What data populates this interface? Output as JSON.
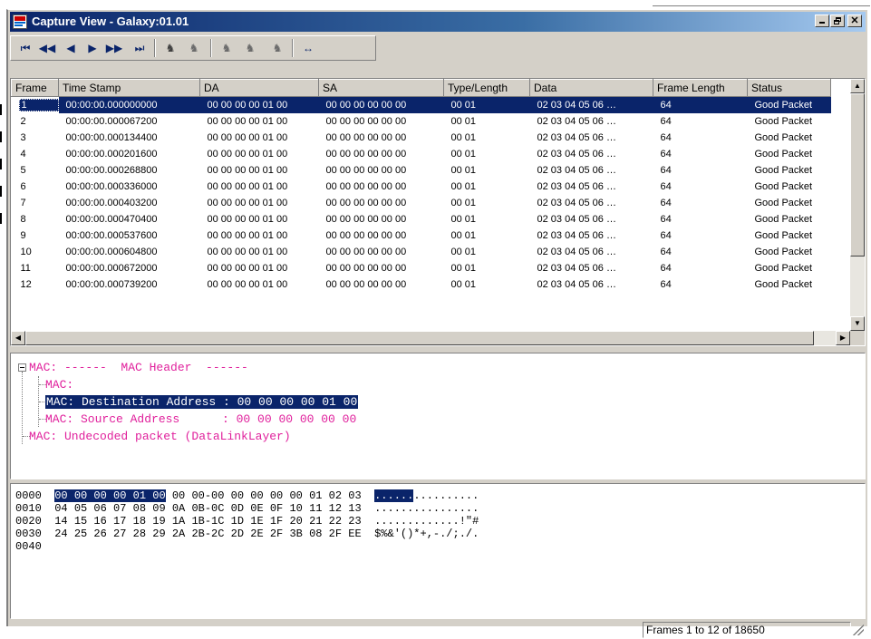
{
  "window": {
    "title": "Capture View - Galaxy:01.01",
    "minimize": "_",
    "close": "✕"
  },
  "toolbar": {
    "first": "⏮",
    "prev_page": "◀◀",
    "prev": "◀",
    "next": "▶",
    "next_page": "▶▶",
    "last": "⏭",
    "find1": "♞",
    "find2": "♞",
    "find3": "♞",
    "find4": "♞",
    "find5": "♞",
    "goto": "↔"
  },
  "list": {
    "columns": [
      "Frame",
      "Time Stamp",
      "DA",
      "SA",
      "Type/Length",
      "Data",
      "Frame Length",
      "Status"
    ],
    "rows": [
      [
        "1",
        "00:00:00.000000000",
        "00 00 00 00 01 00",
        "00 00 00 00 00 00",
        "00 01",
        "02 03 04 05 06 …",
        "64",
        "Good Packet"
      ],
      [
        "2",
        "00:00:00.000067200",
        "00 00 00 00 01 00",
        "00 00 00 00 00 00",
        "00 01",
        "02 03 04 05 06 …",
        "64",
        "Good Packet"
      ],
      [
        "3",
        "00:00:00.000134400",
        "00 00 00 00 01 00",
        "00 00 00 00 00 00",
        "00 01",
        "02 03 04 05 06 …",
        "64",
        "Good Packet"
      ],
      [
        "4",
        "00:00:00.000201600",
        "00 00 00 00 01 00",
        "00 00 00 00 00 00",
        "00 01",
        "02 03 04 05 06 …",
        "64",
        "Good Packet"
      ],
      [
        "5",
        "00:00:00.000268800",
        "00 00 00 00 01 00",
        "00 00 00 00 00 00",
        "00 01",
        "02 03 04 05 06 …",
        "64",
        "Good Packet"
      ],
      [
        "6",
        "00:00:00.000336000",
        "00 00 00 00 01 00",
        "00 00 00 00 00 00",
        "00 01",
        "02 03 04 05 06 …",
        "64",
        "Good Packet"
      ],
      [
        "7",
        "00:00:00.000403200",
        "00 00 00 00 01 00",
        "00 00 00 00 00 00",
        "00 01",
        "02 03 04 05 06 …",
        "64",
        "Good Packet"
      ],
      [
        "8",
        "00:00:00.000470400",
        "00 00 00 00 01 00",
        "00 00 00 00 00 00",
        "00 01",
        "02 03 04 05 06 …",
        "64",
        "Good Packet"
      ],
      [
        "9",
        "00:00:00.000537600",
        "00 00 00 00 01 00",
        "00 00 00 00 00 00",
        "00 01",
        "02 03 04 05 06 …",
        "64",
        "Good Packet"
      ],
      [
        "10",
        "00:00:00.000604800",
        "00 00 00 00 01 00",
        "00 00 00 00 00 00",
        "00 01",
        "02 03 04 05 06 …",
        "64",
        "Good Packet"
      ],
      [
        "11",
        "00:00:00.000672000",
        "00 00 00 00 01 00",
        "00 00 00 00 00 00",
        "00 01",
        "02 03 04 05 06 …",
        "64",
        "Good Packet"
      ],
      [
        "12",
        "00:00:00.000739200",
        "00 00 00 00 01 00",
        "00 00 00 00 00 00",
        "00 01",
        "02 03 04 05 06 …",
        "64",
        "Good Packet"
      ]
    ],
    "selected_row": 0
  },
  "tree": {
    "root": "MAC: ------  MAC Header  ------",
    "child1": "MAC:",
    "child2": "MAC: Destination Address : 00 00 00 00 01 00",
    "child3": "MAC: Source Address      : 00 00 00 00 00 00",
    "sibling": "MAC: Undecoded packet (DataLinkLayer)"
  },
  "hex": {
    "rows": [
      {
        "offset": "0000",
        "sel": "00 00 00 00 01 00",
        "rest": " 00 00-00 00 00 00 00 01 02 03",
        "ascii_sel": "......",
        "ascii_rest": ".........."
      },
      {
        "offset": "0010",
        "sel": "",
        "rest": "04 05 06 07 08 09 0A 0B-0C 0D 0E 0F 10 11 12 13",
        "ascii_sel": "",
        "ascii_rest": "................"
      },
      {
        "offset": "0020",
        "sel": "",
        "rest": "14 15 16 17 18 19 1A 1B-1C 1D 1E 1F 20 21 22 23",
        "ascii_sel": "",
        "ascii_rest": ".............!\"#"
      },
      {
        "offset": "0030",
        "sel": "",
        "rest": "24 25 26 27 28 29 2A 2B-2C 2D 2E 2F 3B 08 2F EE",
        "ascii_sel": "",
        "ascii_rest": "$%&'()*+,-./;./."
      },
      {
        "offset": "0040",
        "sel": "",
        "rest": "",
        "ascii_sel": "",
        "ascii_rest": ""
      }
    ]
  },
  "status": {
    "frames": "Frames 1 to 12 of 18650"
  },
  "colors": {
    "selection": "#0a246a",
    "tree_text": "#e0209c",
    "chrome": "#d4d0c8"
  }
}
